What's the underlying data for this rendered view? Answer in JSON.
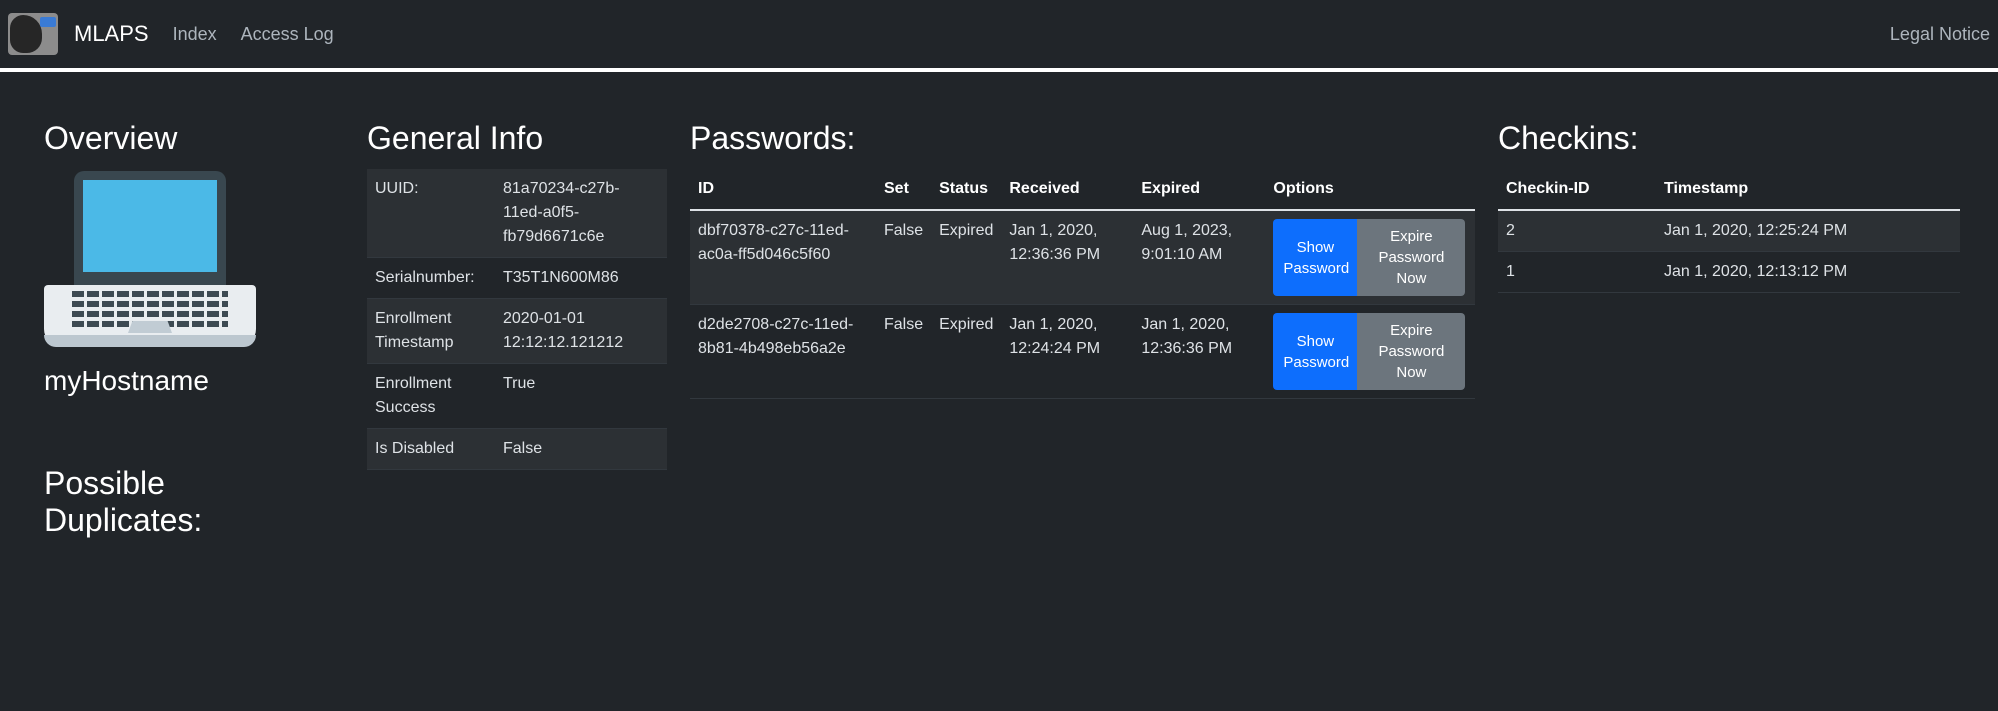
{
  "navbar": {
    "brand": "MLAPS",
    "links": [
      "Index",
      "Access Log"
    ],
    "right_link": "Legal Notice"
  },
  "overview": {
    "title": "Overview",
    "hostname": "myHostname",
    "duplicates_title": "Possible Duplicates:"
  },
  "general": {
    "title": "General Info",
    "rows": [
      {
        "key": "UUID:",
        "value": "81a70234-c27b-11ed-a0f5-fb79d6671c6e"
      },
      {
        "key": "Serialnumber:",
        "value": "T35T1N600M86"
      },
      {
        "key": "Enrollment Timestamp",
        "value": "2020-01-01 12:12:12.121212"
      },
      {
        "key": "Enrollment Success",
        "value": "True"
      },
      {
        "key": "Is Disabled",
        "value": "False"
      }
    ]
  },
  "passwords": {
    "title": "Passwords:",
    "headers": [
      "ID",
      "Set",
      "Status",
      "Received",
      "Expired",
      "Options"
    ],
    "rows": [
      {
        "id": "dbf70378-c27c-11ed-ac0a-ff5d046c5f60",
        "set": "False",
        "status": "Expired",
        "received": "Jan 1, 2020, 12:36:36 PM",
        "expired": "Aug 1, 2023, 9:01:10 AM",
        "show_label": "Show Password",
        "expire_label": "Expire Password Now"
      },
      {
        "id": "d2de2708-c27c-11ed-8b81-4b498eb56a2e",
        "set": "False",
        "status": "Expired",
        "received": "Jan 1, 2020, 12:24:24 PM",
        "expired": "Jan 1, 2020, 12:36:36 PM",
        "show_label": "Show Password",
        "expire_label": "Expire Password Now"
      }
    ]
  },
  "checkins": {
    "title": "Checkins:",
    "headers": [
      "Checkin-ID",
      "Timestamp"
    ],
    "rows": [
      {
        "id": "2",
        "timestamp": "Jan 1, 2020, 12:25:24 PM"
      },
      {
        "id": "1",
        "timestamp": "Jan 1, 2020, 12:13:12 PM"
      }
    ]
  },
  "colors": {
    "background": "#212529",
    "primary_button": "#0d6efd",
    "secondary_button": "#6c757d"
  }
}
